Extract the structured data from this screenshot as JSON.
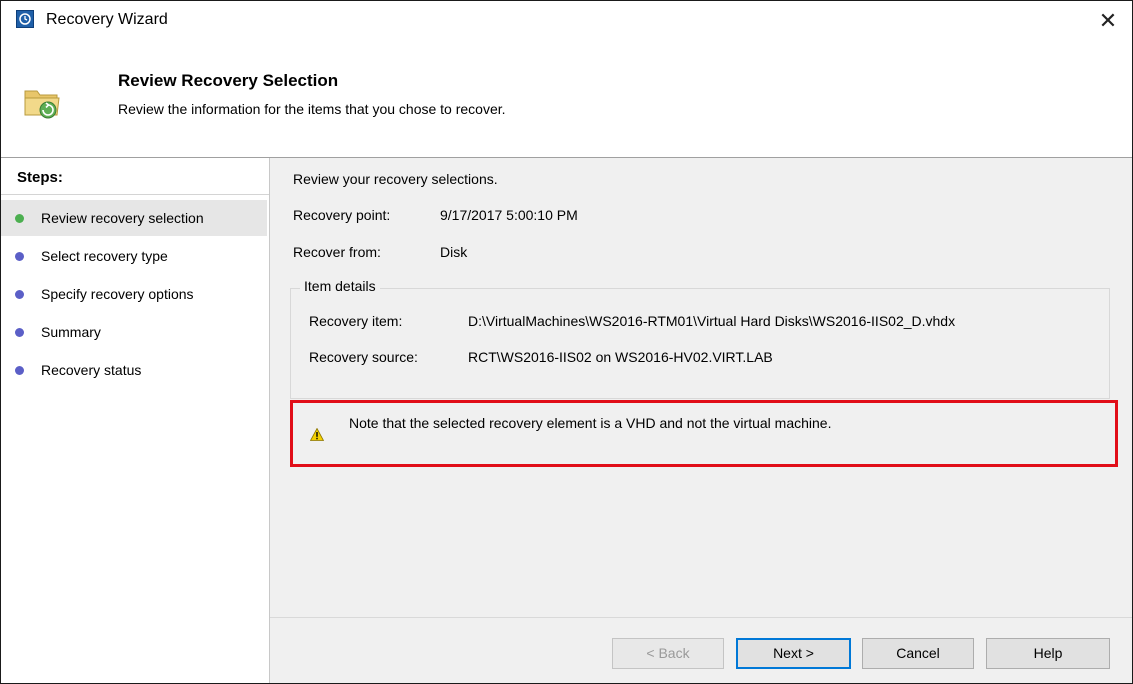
{
  "window": {
    "title": "Recovery Wizard",
    "close_glyph": "✕",
    "app_icon": "backup-clock-icon"
  },
  "header": {
    "title": "Review Recovery Selection",
    "subtitle": "Review the information for the items that you chose to recover.",
    "icon": "folder-restore-icon"
  },
  "steps": {
    "title": "Steps:",
    "items": [
      {
        "label": "Review recovery selection",
        "status": "current",
        "color": "#4caf50"
      },
      {
        "label": "Select recovery type",
        "status": "pending",
        "color": "#5b5fc7"
      },
      {
        "label": "Specify recovery options",
        "status": "pending",
        "color": "#5b5fc7"
      },
      {
        "label": "Summary",
        "status": "pending",
        "color": "#5b5fc7"
      },
      {
        "label": "Recovery status",
        "status": "pending",
        "color": "#5b5fc7"
      }
    ]
  },
  "main": {
    "intro": "Review your recovery selections.",
    "recovery_point_label": "Recovery point:",
    "recovery_point_value": "9/17/2017 5:00:10 PM",
    "recover_from_label": "Recover from:",
    "recover_from_value": "Disk",
    "item_details": {
      "legend": "Item details",
      "recovery_item_label": "Recovery item:",
      "recovery_item_value": "D:\\VirtualMachines\\WS2016-RTM01\\Virtual Hard Disks\\WS2016-IIS02_D.vhdx",
      "recovery_source_label": "Recovery source:",
      "recovery_source_value": "RCT\\WS2016-IIS02 on WS2016-HV02.VIRT.LAB"
    },
    "warning": {
      "icon": "warning-icon",
      "text": "Note that the selected recovery element is a VHD and not the virtual machine.",
      "highlight_color": "#e10e18"
    }
  },
  "buttons": {
    "back": "< Back",
    "next": "Next >",
    "cancel": "Cancel",
    "help": "Help"
  }
}
